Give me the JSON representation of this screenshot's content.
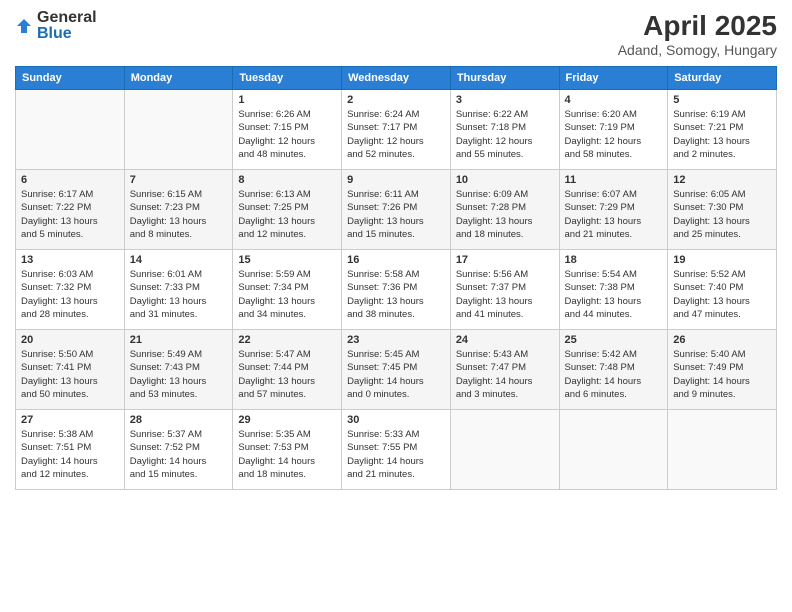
{
  "logo": {
    "general": "General",
    "blue": "Blue"
  },
  "title": "April 2025",
  "subtitle": "Adand, Somogy, Hungary",
  "days_of_week": [
    "Sunday",
    "Monday",
    "Tuesday",
    "Wednesday",
    "Thursday",
    "Friday",
    "Saturday"
  ],
  "weeks": [
    [
      {
        "day": "",
        "info": ""
      },
      {
        "day": "",
        "info": ""
      },
      {
        "day": "1",
        "info": "Sunrise: 6:26 AM\nSunset: 7:15 PM\nDaylight: 12 hours\nand 48 minutes."
      },
      {
        "day": "2",
        "info": "Sunrise: 6:24 AM\nSunset: 7:17 PM\nDaylight: 12 hours\nand 52 minutes."
      },
      {
        "day": "3",
        "info": "Sunrise: 6:22 AM\nSunset: 7:18 PM\nDaylight: 12 hours\nand 55 minutes."
      },
      {
        "day": "4",
        "info": "Sunrise: 6:20 AM\nSunset: 7:19 PM\nDaylight: 12 hours\nand 58 minutes."
      },
      {
        "day": "5",
        "info": "Sunrise: 6:19 AM\nSunset: 7:21 PM\nDaylight: 13 hours\nand 2 minutes."
      }
    ],
    [
      {
        "day": "6",
        "info": "Sunrise: 6:17 AM\nSunset: 7:22 PM\nDaylight: 13 hours\nand 5 minutes."
      },
      {
        "day": "7",
        "info": "Sunrise: 6:15 AM\nSunset: 7:23 PM\nDaylight: 13 hours\nand 8 minutes."
      },
      {
        "day": "8",
        "info": "Sunrise: 6:13 AM\nSunset: 7:25 PM\nDaylight: 13 hours\nand 12 minutes."
      },
      {
        "day": "9",
        "info": "Sunrise: 6:11 AM\nSunset: 7:26 PM\nDaylight: 13 hours\nand 15 minutes."
      },
      {
        "day": "10",
        "info": "Sunrise: 6:09 AM\nSunset: 7:28 PM\nDaylight: 13 hours\nand 18 minutes."
      },
      {
        "day": "11",
        "info": "Sunrise: 6:07 AM\nSunset: 7:29 PM\nDaylight: 13 hours\nand 21 minutes."
      },
      {
        "day": "12",
        "info": "Sunrise: 6:05 AM\nSunset: 7:30 PM\nDaylight: 13 hours\nand 25 minutes."
      }
    ],
    [
      {
        "day": "13",
        "info": "Sunrise: 6:03 AM\nSunset: 7:32 PM\nDaylight: 13 hours\nand 28 minutes."
      },
      {
        "day": "14",
        "info": "Sunrise: 6:01 AM\nSunset: 7:33 PM\nDaylight: 13 hours\nand 31 minutes."
      },
      {
        "day": "15",
        "info": "Sunrise: 5:59 AM\nSunset: 7:34 PM\nDaylight: 13 hours\nand 34 minutes."
      },
      {
        "day": "16",
        "info": "Sunrise: 5:58 AM\nSunset: 7:36 PM\nDaylight: 13 hours\nand 38 minutes."
      },
      {
        "day": "17",
        "info": "Sunrise: 5:56 AM\nSunset: 7:37 PM\nDaylight: 13 hours\nand 41 minutes."
      },
      {
        "day": "18",
        "info": "Sunrise: 5:54 AM\nSunset: 7:38 PM\nDaylight: 13 hours\nand 44 minutes."
      },
      {
        "day": "19",
        "info": "Sunrise: 5:52 AM\nSunset: 7:40 PM\nDaylight: 13 hours\nand 47 minutes."
      }
    ],
    [
      {
        "day": "20",
        "info": "Sunrise: 5:50 AM\nSunset: 7:41 PM\nDaylight: 13 hours\nand 50 minutes."
      },
      {
        "day": "21",
        "info": "Sunrise: 5:49 AM\nSunset: 7:43 PM\nDaylight: 13 hours\nand 53 minutes."
      },
      {
        "day": "22",
        "info": "Sunrise: 5:47 AM\nSunset: 7:44 PM\nDaylight: 13 hours\nand 57 minutes."
      },
      {
        "day": "23",
        "info": "Sunrise: 5:45 AM\nSunset: 7:45 PM\nDaylight: 14 hours\nand 0 minutes."
      },
      {
        "day": "24",
        "info": "Sunrise: 5:43 AM\nSunset: 7:47 PM\nDaylight: 14 hours\nand 3 minutes."
      },
      {
        "day": "25",
        "info": "Sunrise: 5:42 AM\nSunset: 7:48 PM\nDaylight: 14 hours\nand 6 minutes."
      },
      {
        "day": "26",
        "info": "Sunrise: 5:40 AM\nSunset: 7:49 PM\nDaylight: 14 hours\nand 9 minutes."
      }
    ],
    [
      {
        "day": "27",
        "info": "Sunrise: 5:38 AM\nSunset: 7:51 PM\nDaylight: 14 hours\nand 12 minutes."
      },
      {
        "day": "28",
        "info": "Sunrise: 5:37 AM\nSunset: 7:52 PM\nDaylight: 14 hours\nand 15 minutes."
      },
      {
        "day": "29",
        "info": "Sunrise: 5:35 AM\nSunset: 7:53 PM\nDaylight: 14 hours\nand 18 minutes."
      },
      {
        "day": "30",
        "info": "Sunrise: 5:33 AM\nSunset: 7:55 PM\nDaylight: 14 hours\nand 21 minutes."
      },
      {
        "day": "",
        "info": ""
      },
      {
        "day": "",
        "info": ""
      },
      {
        "day": "",
        "info": ""
      }
    ]
  ]
}
